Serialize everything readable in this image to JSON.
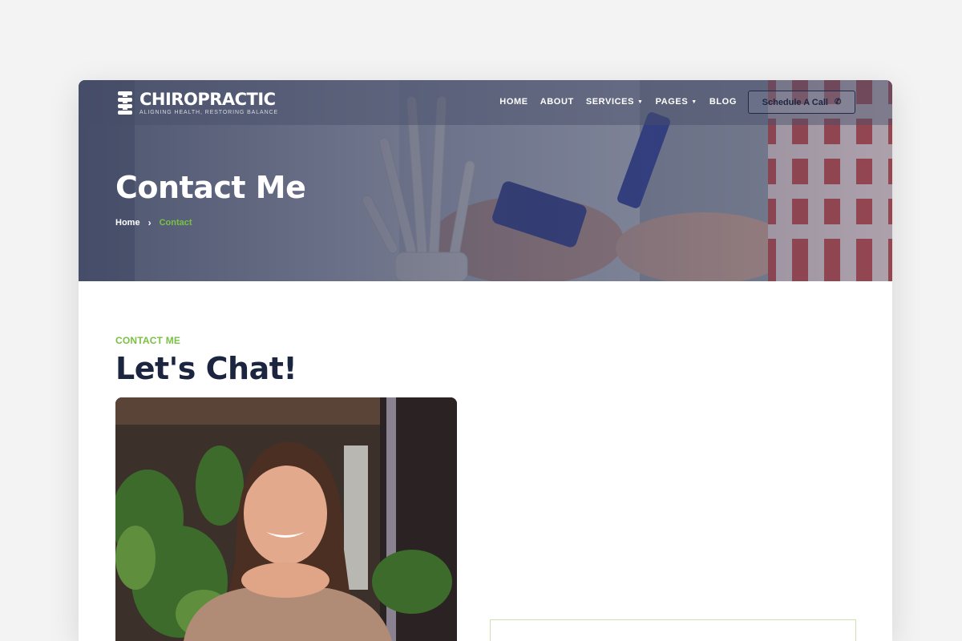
{
  "brand": {
    "name": "CHIROPRACTIC",
    "tagline": "ALIGNING HEALTH, RESTORING BALANCE"
  },
  "nav": {
    "items": [
      {
        "label": "HOME"
      },
      {
        "label": "ABOUT"
      },
      {
        "label": "SERVICES"
      },
      {
        "label": "PAGES"
      },
      {
        "label": "BLOG"
      }
    ],
    "cta": "Schedule A Call"
  },
  "hero": {
    "title": "Contact Me",
    "breadcrumb": {
      "home": "Home",
      "separator": "›",
      "current": "Contact"
    }
  },
  "section": {
    "eyebrow": "CONTACT ME",
    "heading": "Let's Chat!"
  },
  "colors": {
    "accent": "#7ac143",
    "navy": "#1b2540",
    "page_bg": "#f3f3f3"
  },
  "icons": {
    "logo": "spine-icon",
    "dropdown": "chevron-down-icon",
    "cta": "phone-icon"
  }
}
